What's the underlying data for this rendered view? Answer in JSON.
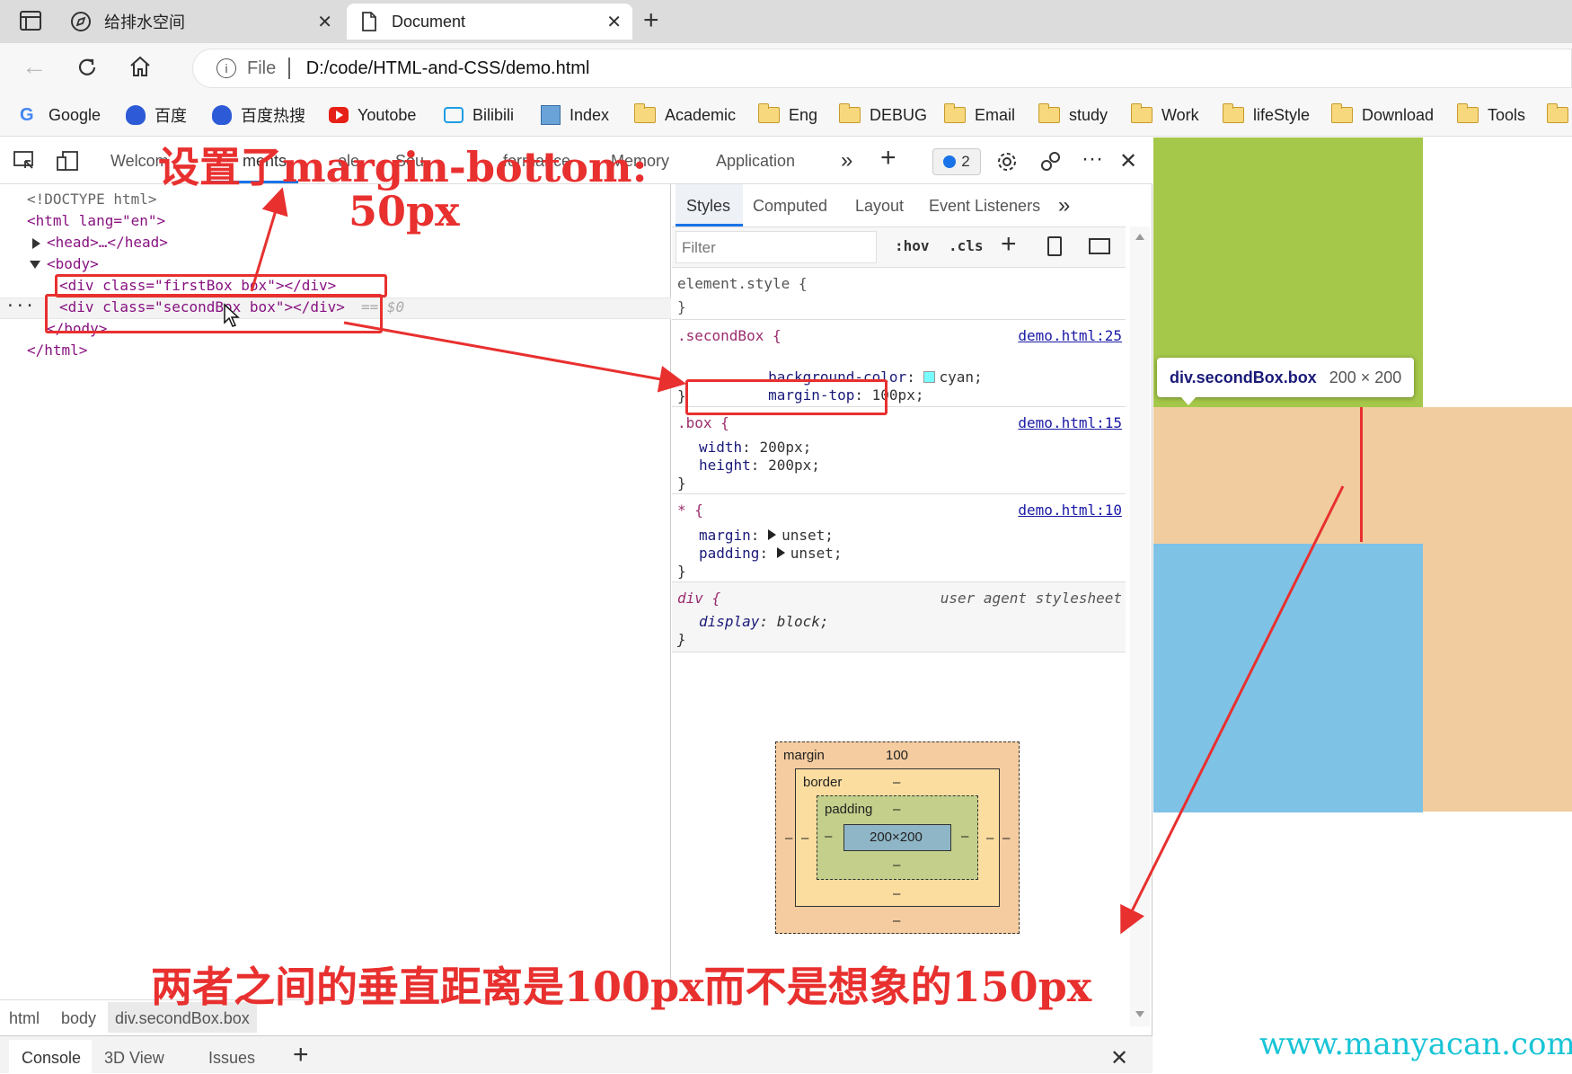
{
  "tabs": [
    {
      "title": "给排水空间",
      "icon": "compass-icon",
      "active": false
    },
    {
      "title": "Document",
      "icon": "page-icon",
      "active": true
    }
  ],
  "address": {
    "scheme_label": "File",
    "url": "D:/code/HTML-and-CSS/demo.html"
  },
  "bookmarks": [
    {
      "label": "Google",
      "icon": "google-icon"
    },
    {
      "label": "百度",
      "icon": "baidu-icon"
    },
    {
      "label": "百度热搜",
      "icon": "baidu-icon"
    },
    {
      "label": "Youtobe",
      "icon": "youtube-icon"
    },
    {
      "label": "Bilibili",
      "icon": "bilibili-icon"
    },
    {
      "label": "Index",
      "icon": "avatar-icon"
    },
    {
      "label": "Academic",
      "icon": "folder-icon"
    },
    {
      "label": "Eng",
      "icon": "folder-icon"
    },
    {
      "label": "DEBUG",
      "icon": "folder-icon"
    },
    {
      "label": "Email",
      "icon": "folder-icon"
    },
    {
      "label": "study",
      "icon": "folder-icon"
    },
    {
      "label": "Work",
      "icon": "folder-icon"
    },
    {
      "label": "lifeStyle",
      "icon": "folder-icon"
    },
    {
      "label": "Download",
      "icon": "folder-icon"
    },
    {
      "label": "Tools",
      "icon": "folder-icon"
    }
  ],
  "devtools": {
    "tabs": [
      "Welcome",
      "Elements",
      "Console",
      "Sources",
      "Performance",
      "Memory",
      "Application"
    ],
    "tab_fragments": {
      "welcome": "Welcom",
      "elements": "ments",
      "console": "ole",
      "sources": "Sou",
      "performance": "formance",
      "memory": "Memory",
      "application": "Application"
    },
    "issues_count": "2",
    "dom": {
      "doctype": "<!DOCTYPE html>",
      "html_open": "<html lang=\"en\">",
      "head": "<head>…</head>",
      "body_open": "<body>",
      "first_box": "<div class=\"firstBox box\"></div>",
      "second_box": "<div class=\"secondBox box\"></div>",
      "second_suffix": "== $0",
      "body_close": "</body>",
      "html_close": "</html>"
    },
    "styles_tabs": [
      "Styles",
      "Computed",
      "Layout",
      "Event Listeners"
    ],
    "filter_placeholder": "Filter",
    "hov": ":hov",
    "cls": ".cls",
    "rules": {
      "element_style": {
        "selector": "element.style {",
        "close": "}"
      },
      "second_box": {
        "selector": ".secondBox {",
        "source": "demo.html:25",
        "bg_prop": "background-color",
        "bg_val": "cyan;",
        "mt_prop": "margin-top",
        "mt_val": "100px;",
        "close": "}"
      },
      "box": {
        "selector": ".box {",
        "source": "demo.html:15",
        "w_prop": "width",
        "w_val": "200px;",
        "h_prop": "height",
        "h_val": "200px;",
        "close": "}"
      },
      "star": {
        "selector": "* {",
        "source": "demo.html:10",
        "m_prop": "margin",
        "m_val": "unset;",
        "p_prop": "padding",
        "p_val": "unset;",
        "close": "}"
      },
      "div": {
        "selector": "div {",
        "source": "user agent stylesheet",
        "d_prop": "display",
        "d_val": "block;",
        "close": "}"
      }
    },
    "box_model": {
      "margin_label": "margin",
      "margin_top": "100",
      "border_label": "border",
      "padding_label": "padding",
      "content": "200×200",
      "dash": "–"
    },
    "breadcrumbs": [
      "html",
      "body",
      "div.secondBox.box"
    ],
    "drawer_tabs": [
      "Console",
      "3D View",
      "Issues"
    ]
  },
  "tooltip": {
    "name": "div.secondBox.box",
    "size": "200 × 200"
  },
  "colors": {
    "green_box": "#a5c84a",
    "margin_overlay": "#f0cc9e",
    "content_overlay": "#7ec2e6",
    "annotation": "#e8302f"
  },
  "annotations": {
    "top_line1": "设置了margin-bottom:",
    "top_line2": "50px",
    "bottom": "两者之间的垂直距离是100px而不是想象的150px"
  },
  "watermark": "www.manyacan.com"
}
